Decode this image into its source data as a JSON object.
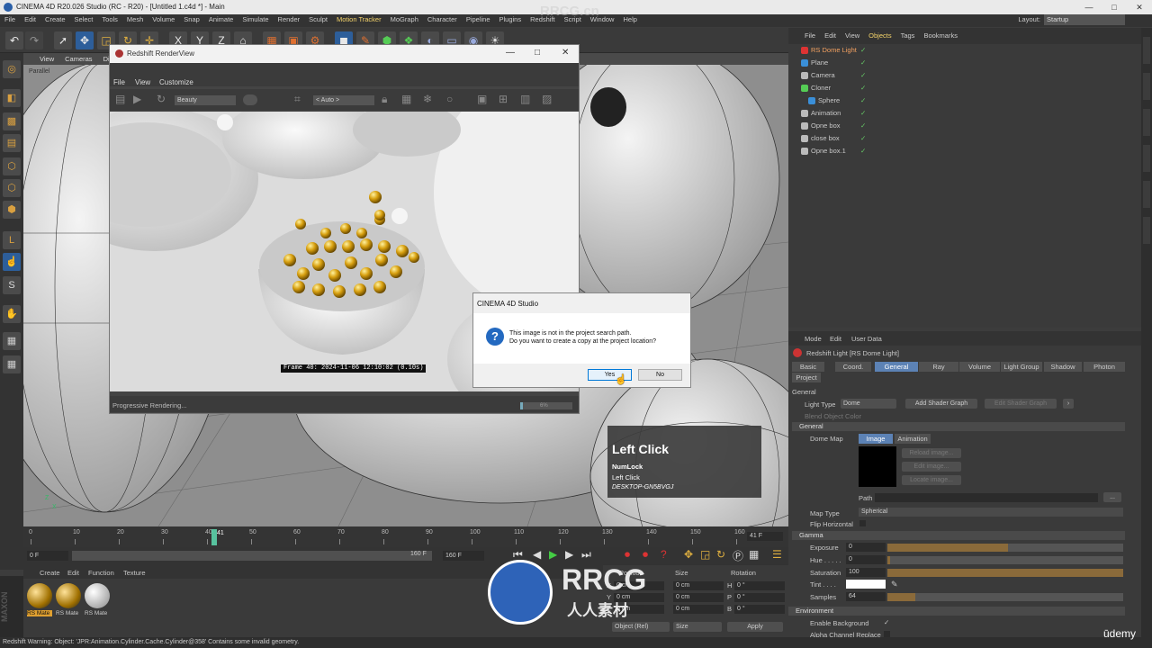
{
  "window": {
    "title": "CINEMA 4D R20.026 Studio (RC - R20) - [Untitled 1.c4d *] - Main",
    "min": "—",
    "max": "□",
    "close": "✕"
  },
  "menubar": [
    "File",
    "Edit",
    "Create",
    "Select",
    "Tools",
    "Mesh",
    "Volume",
    "Snap",
    "Animate",
    "Simulate",
    "Render",
    "Sculpt",
    "Motion Tracker",
    "MoGraph",
    "Character",
    "Pipeline",
    "Plugins",
    "Redshift",
    "Script",
    "Window",
    "Help"
  ],
  "layout": {
    "label": "Layout:",
    "value": "Startup"
  },
  "viewport": {
    "menus": [
      "View",
      "Cameras",
      "Display"
    ],
    "label": "Parallel"
  },
  "renderview": {
    "title": "Redshift RenderView",
    "menus": [
      "File",
      "View",
      "Customize"
    ],
    "aov": "Beauty",
    "zoom": "< Auto >",
    "frame_info": "Frame  40:  2024-11-06  12:10:02  (0.10s)",
    "status": "Progressive Rendering...",
    "progress_text": "6%",
    "progress": 0.06
  },
  "dialog": {
    "title": "CINEMA 4D Studio",
    "line1": "This image is not in the project search path.",
    "line2": "Do you want to create a copy at the project location?",
    "yes": "Yes",
    "no": "No"
  },
  "key_overlay": {
    "main": "Left Click",
    "keys": [
      "NumLock",
      "Left Click"
    ],
    "machine": "DESKTOP-GN5BVGJ"
  },
  "objects": {
    "menus": [
      "File",
      "Edit",
      "View",
      "Objects",
      "Tags",
      "Bookmarks"
    ],
    "items": [
      {
        "name": "RS Dome Light",
        "color": "#d33"
      },
      {
        "name": "Plane",
        "color": "#3a8fd8"
      },
      {
        "name": "Camera",
        "color": "#bbb"
      },
      {
        "name": "Cloner",
        "color": "#5c5"
      },
      {
        "name": "Sphere",
        "color": "#3a8fd8"
      },
      {
        "name": "Animation",
        "color": "#bbb"
      },
      {
        "name": "Opne box",
        "color": "#bbb"
      },
      {
        "name": "close box",
        "color": "#bbb"
      },
      {
        "name": "Opne box.1",
        "color": "#bbb"
      }
    ]
  },
  "attributes": {
    "menus": [
      "Mode",
      "Edit",
      "User Data"
    ],
    "object_title": "Redshift Light [RS Dome Light]",
    "tabs": [
      "Basic",
      "Coord.",
      "General",
      "Ray",
      "Volume",
      "Light Group",
      "Shadow",
      "Photon",
      "Project"
    ],
    "active_tab": "General",
    "section_general": "General",
    "light_type_label": "Light Type",
    "light_type": "Dome",
    "add_shader_graph": "Add Shader Graph",
    "edit_shader_graph": "Edit Shader Graph",
    "blend_label": "Blend Object Color",
    "general_sub": "General",
    "dome_map_label": "Dome Map",
    "image_tab": "Image",
    "animation_tab": "Animation",
    "reload_image": "Reload image...",
    "edit_image": "Edit image...",
    "locate_image": "Locate image...",
    "path_label": "Path",
    "path_btn": "...",
    "map_type_label": "Map Type",
    "map_type": "Spherical",
    "flip_label": "Flip Horizontal",
    "gamma": "Gamma",
    "exposure_label": "Exposure",
    "exposure": "0",
    "hue_label": "Hue . . . . .",
    "hue": "0",
    "saturation_label": "Saturation",
    "saturation": "100",
    "tint_label": "Tint . . . .",
    "samples_label": "Samples",
    "samples": "64",
    "environment": "Environment",
    "enable_bg_label": "Enable Background",
    "alpha_label": "Alpha Channel Replace"
  },
  "timeline": {
    "ticks": [
      "0",
      "10",
      "20",
      "30",
      "40",
      "50",
      "60",
      "70",
      "80",
      "90",
      "100",
      "110",
      "120",
      "130",
      "140",
      "150",
      "160"
    ],
    "current": "41",
    "current_frame_box": "41 F",
    "start": "0 F",
    "end": "160 F",
    "end2": "160 F"
  },
  "materials": {
    "menus": [
      "Create",
      "Edit",
      "Function",
      "Texture"
    ],
    "items": [
      "RS Mate",
      "RS Mate",
      "RS Mate"
    ]
  },
  "coords": {
    "headers": [
      "Position",
      "Size",
      "Rotation"
    ],
    "pos": [
      "0 cm",
      "0 cm",
      "0 cm"
    ],
    "size": [
      "0 cm",
      "0 cm",
      "0 cm"
    ],
    "rot_labels": [
      "H",
      "P",
      "B"
    ],
    "rot": [
      "0 °",
      "0 °",
      "0 °"
    ],
    "mode": "Object (Rel)",
    "size_mode": "Size",
    "apply": "Apply"
  },
  "status": "Redshift Warning: Object: 'JPR:Animation.Cylinder.Cache.Cylinder@358' Contains some invalid geometry.",
  "watermarks": {
    "top": "RRCG.cn",
    "logo_main": "RRCG",
    "logo_sub": "人人素材",
    "udemy": "ūdemy"
  }
}
